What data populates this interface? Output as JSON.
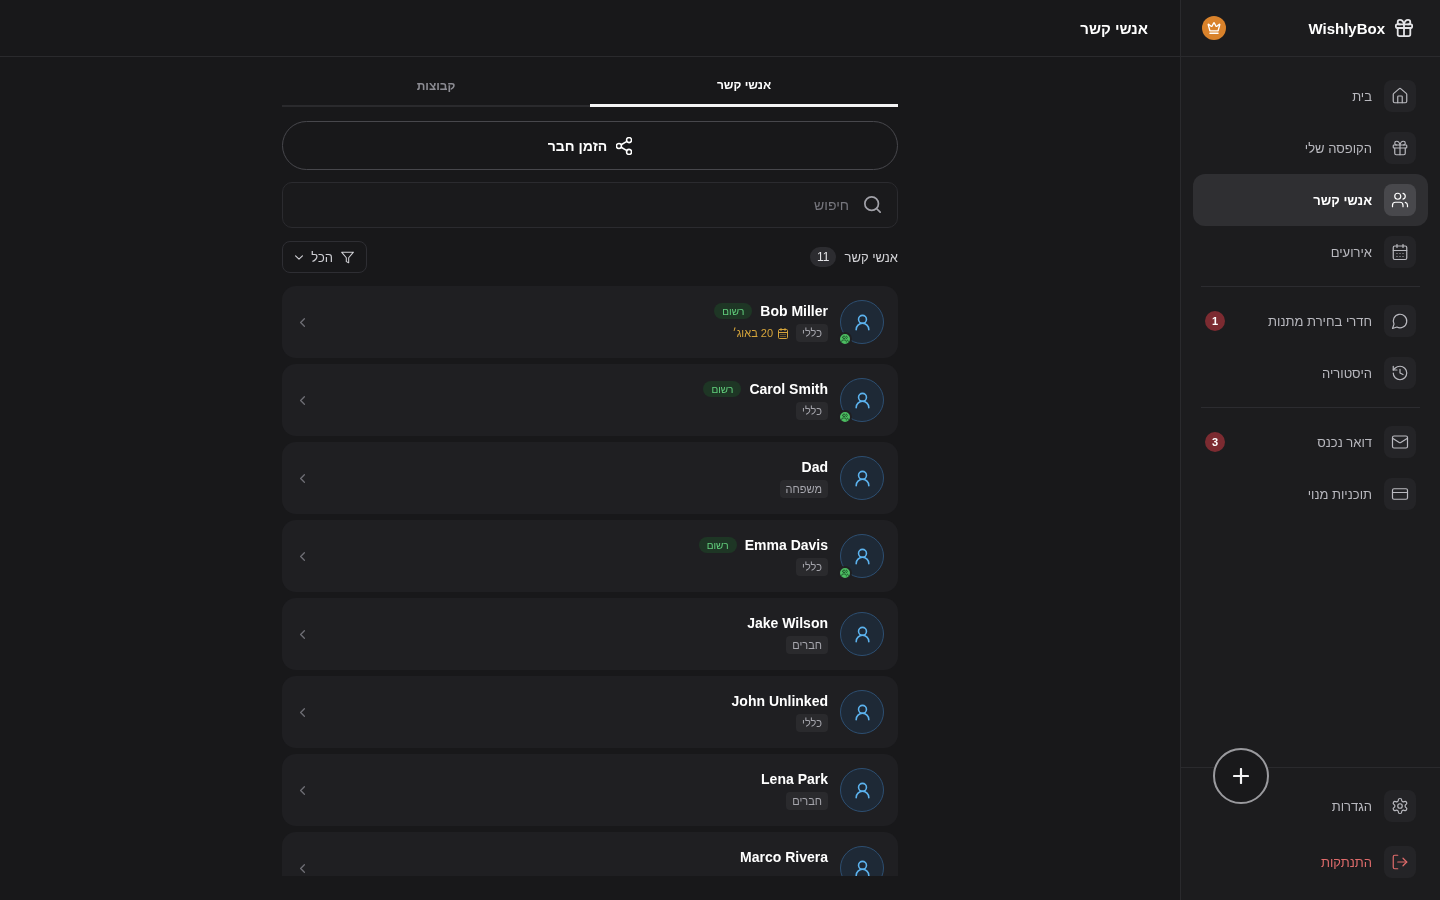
{
  "sidebar": {
    "brand": "WishlyBox",
    "sections": [
      {
        "items": [
          {
            "kind": "home",
            "label": "בית",
            "selected": false
          },
          {
            "kind": "box",
            "label": "הקופסה שלי",
            "selected": false
          },
          {
            "kind": "contacts",
            "label": "אנשי קשר",
            "selected": true
          },
          {
            "kind": "events",
            "label": "אירועים",
            "selected": false
          }
        ]
      },
      {
        "items": [
          {
            "kind": "rooms",
            "label": "חדרי בחירת מתנות",
            "selected": false,
            "badge": "1"
          },
          {
            "kind": "history",
            "label": "היסטוריה",
            "selected": false
          }
        ]
      },
      {
        "items": [
          {
            "kind": "inbox",
            "label": "דואר נכנס",
            "selected": false,
            "badge": "3"
          },
          {
            "kind": "plans",
            "label": "תוכניות מנוי",
            "selected": false
          }
        ]
      }
    ],
    "footer_items": [
      {
        "kind": "settings",
        "label": "הגדרות",
        "selected": false
      },
      {
        "kind": "logout",
        "label": "התנתקות",
        "selected": false
      }
    ]
  },
  "header": {
    "title": "אנשי קשר"
  },
  "tabs": [
    {
      "label": "אנשי קשר",
      "selected": true
    },
    {
      "label": "קבוצות",
      "selected": false
    }
  ],
  "invite_button": {
    "label": "הזמן חבר"
  },
  "search": {
    "placeholder": "חיפוש"
  },
  "list_header": {
    "label": "אנשי קשר",
    "count": "11",
    "filter": "הכל"
  },
  "contacts": [
    {
      "name": "Bob Miller",
      "badge": "רשום",
      "linked": true,
      "tag": "כללי",
      "birthday": "20 באוג׳"
    },
    {
      "name": "Carol Smith",
      "badge": "רשום",
      "linked": true,
      "tag": "כללי"
    },
    {
      "name": "Dad",
      "linked": false,
      "tag": "משפחה"
    },
    {
      "name": "Emma Davis",
      "badge": "רשום",
      "linked": true,
      "tag": "כללי"
    },
    {
      "name": "Jake Wilson",
      "linked": false,
      "tag": "חברים"
    },
    {
      "name": "John Unlinked",
      "linked": false,
      "tag": "כללי"
    },
    {
      "name": "Lena Park",
      "linked": false,
      "tag": "חברים"
    },
    {
      "name": "Marco Rivera",
      "linked": false
    }
  ]
}
